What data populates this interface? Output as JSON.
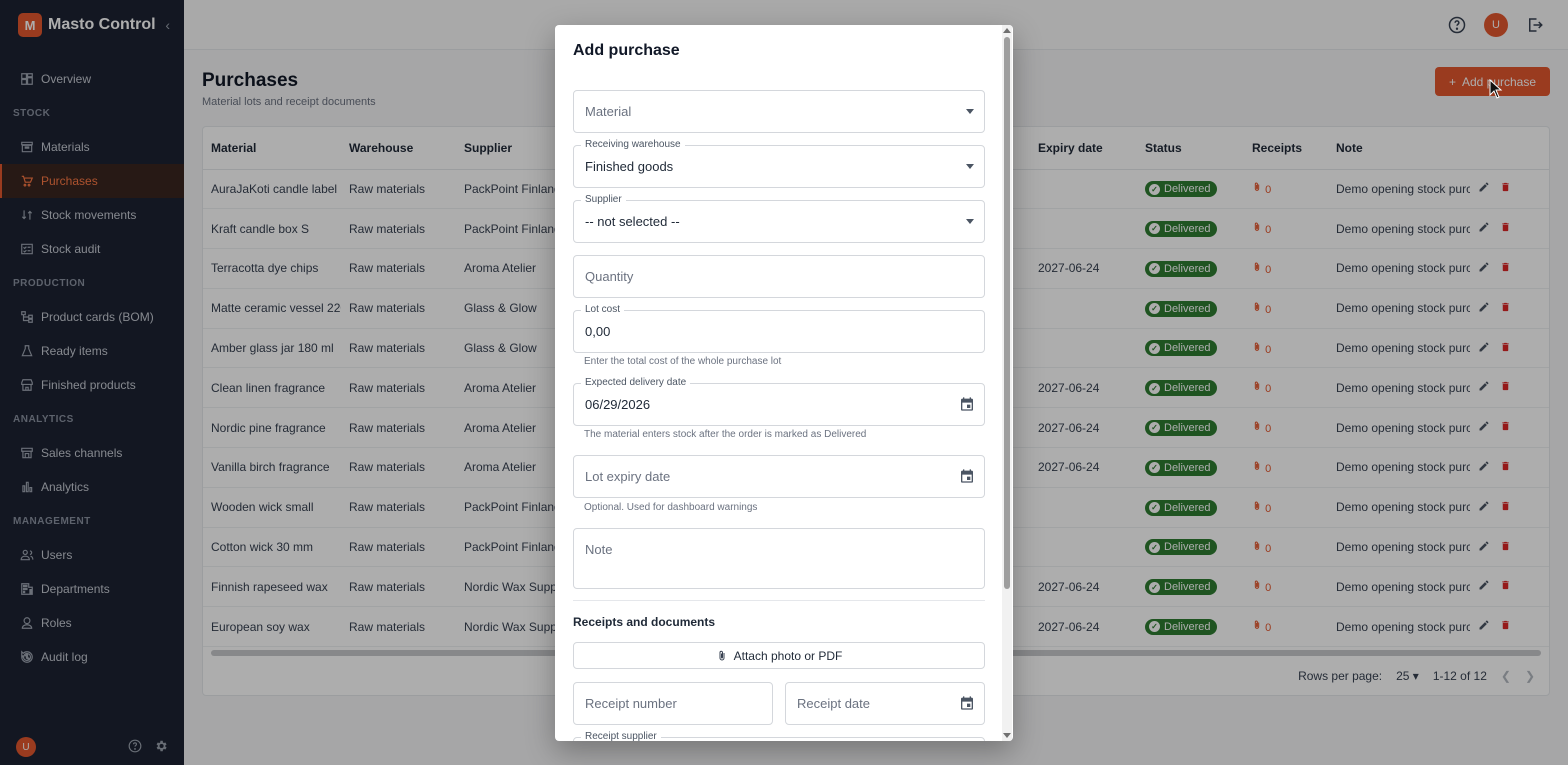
{
  "app": {
    "logo_letter": "M",
    "name": "Masto Control"
  },
  "sidebar": {
    "items": [
      {
        "label": "Overview",
        "icon": "dashboard-icon"
      },
      {
        "section": "STOCK"
      },
      {
        "label": "Materials",
        "icon": "archive-icon"
      },
      {
        "label": "Purchases",
        "icon": "cart-icon",
        "active": true
      },
      {
        "label": "Stock movements",
        "icon": "swap-icon"
      },
      {
        "label": "Stock audit",
        "icon": "checklist-icon"
      },
      {
        "section": "PRODUCTION"
      },
      {
        "label": "Product cards (BOM)",
        "icon": "tree-icon"
      },
      {
        "label": "Ready items",
        "icon": "flask-icon"
      },
      {
        "label": "Finished products",
        "icon": "store-icon"
      },
      {
        "section": "ANALYTICS"
      },
      {
        "label": "Sales channels",
        "icon": "storefront-icon"
      },
      {
        "label": "Analytics",
        "icon": "bar-chart-icon"
      },
      {
        "section": "MANAGEMENT"
      },
      {
        "label": "Users",
        "icon": "users-icon"
      },
      {
        "label": "Departments",
        "icon": "building-icon"
      },
      {
        "label": "Roles",
        "icon": "badge-icon"
      },
      {
        "label": "Audit log",
        "icon": "history-icon"
      }
    ],
    "footer_avatar": "U"
  },
  "topbar": {
    "avatar": "U"
  },
  "page": {
    "title": "Purchases",
    "subtitle": "Material lots and receipt documents",
    "add_button": "Add purchase"
  },
  "table": {
    "columns": [
      "Material",
      "Warehouse",
      "Supplier",
      "",
      "Expiry date",
      "Status",
      "Receipts",
      "Note",
      ""
    ],
    "rows": [
      {
        "material": "AuraJaKoti candle label",
        "warehouse": "Raw materials",
        "supplier": "PackPoint Finland",
        "expiry": "",
        "status": "Delivered",
        "receipts": "0",
        "note": "Demo opening stock purc"
      },
      {
        "material": "Kraft candle box S",
        "warehouse": "Raw materials",
        "supplier": "PackPoint Finland",
        "expiry": "",
        "status": "Delivered",
        "receipts": "0",
        "note": "Demo opening stock purc"
      },
      {
        "material": "Terracotta dye chips",
        "warehouse": "Raw materials",
        "supplier": "Aroma Atelier",
        "expiry": "2027-06-24",
        "status": "Delivered",
        "receipts": "0",
        "note": "Demo opening stock purc"
      },
      {
        "material": "Matte ceramic vessel 220",
        "warehouse": "Raw materials",
        "supplier": "Glass & Glow",
        "expiry": "",
        "status": "Delivered",
        "receipts": "0",
        "note": "Demo opening stock purc"
      },
      {
        "material": "Amber glass jar 180 ml",
        "warehouse": "Raw materials",
        "supplier": "Glass & Glow",
        "expiry": "",
        "status": "Delivered",
        "receipts": "0",
        "note": "Demo opening stock purc"
      },
      {
        "material": "Clean linen fragrance",
        "warehouse": "Raw materials",
        "supplier": "Aroma Atelier",
        "expiry": "2027-06-24",
        "status": "Delivered",
        "receipts": "0",
        "note": "Demo opening stock purc"
      },
      {
        "material": "Nordic pine fragrance",
        "warehouse": "Raw materials",
        "supplier": "Aroma Atelier",
        "expiry": "2027-06-24",
        "status": "Delivered",
        "receipts": "0",
        "note": "Demo opening stock purc"
      },
      {
        "material": "Vanilla birch fragrance",
        "warehouse": "Raw materials",
        "supplier": "Aroma Atelier",
        "expiry": "2027-06-24",
        "status": "Delivered",
        "receipts": "0",
        "note": "Demo opening stock purc"
      },
      {
        "material": "Wooden wick small",
        "warehouse": "Raw materials",
        "supplier": "PackPoint Finland",
        "expiry": "",
        "status": "Delivered",
        "receipts": "0",
        "note": "Demo opening stock purc"
      },
      {
        "material": "Cotton wick 30 mm",
        "warehouse": "Raw materials",
        "supplier": "PackPoint Finland",
        "expiry": "",
        "status": "Delivered",
        "receipts": "0",
        "note": "Demo opening stock purc"
      },
      {
        "material": "Finnish rapeseed wax",
        "warehouse": "Raw materials",
        "supplier": "Nordic Wax Suppl",
        "expiry": "2027-06-24",
        "status": "Delivered",
        "receipts": "0",
        "note": "Demo opening stock purc"
      },
      {
        "material": "European soy wax",
        "warehouse": "Raw materials",
        "supplier": "Nordic Wax Suppl",
        "expiry": "2027-06-24",
        "status": "Delivered",
        "receipts": "0",
        "note": "Demo opening stock purc"
      }
    ]
  },
  "pager": {
    "rows_label": "Rows per page:",
    "rows_value": "25",
    "range": "1-12 of 12"
  },
  "modal": {
    "title": "Add purchase",
    "material": {
      "placeholder": "Material"
    },
    "warehouse": {
      "label": "Receiving warehouse",
      "value": "Finished goods"
    },
    "supplier": {
      "label": "Supplier",
      "value": "-- not selected --"
    },
    "quantity": {
      "placeholder": "Quantity"
    },
    "lot_cost": {
      "label": "Lot cost",
      "value": "0,00",
      "helper": "Enter the total cost of the whole purchase lot"
    },
    "delivery": {
      "label": "Expected delivery date",
      "value": "06/29/2026",
      "helper": "The material enters stock after the order is marked as Delivered"
    },
    "expiry": {
      "placeholder": "Lot expiry date",
      "helper": "Optional. Used for dashboard warnings"
    },
    "note": {
      "placeholder": "Note"
    },
    "receipts_title": "Receipts and documents",
    "attach_label": "Attach photo or PDF",
    "receipt_number": {
      "placeholder": "Receipt number"
    },
    "receipt_date": {
      "placeholder": "Receipt date"
    },
    "receipt_supplier_label": "Receipt supplier"
  },
  "colors": {
    "accent": "#e4572e",
    "sidebar_bg": "#1c2333",
    "success": "#2e7d32"
  }
}
